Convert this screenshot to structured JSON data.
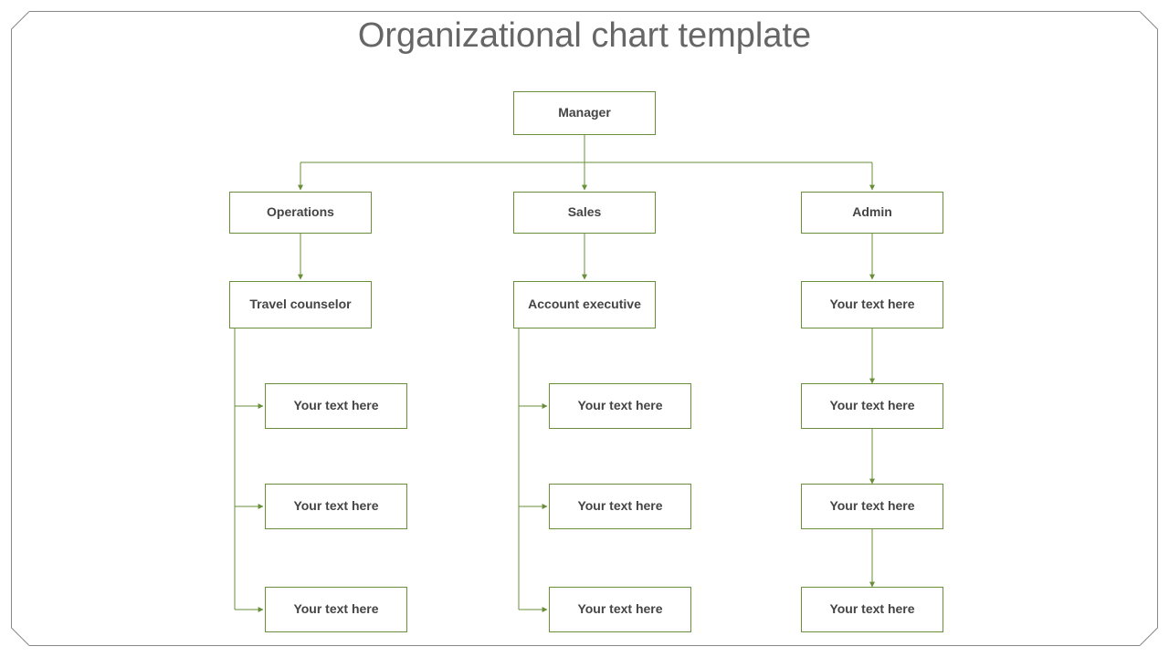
{
  "title": "Organizational chart template",
  "colors": {
    "border": "#6a8f3a",
    "text": "#444",
    "title": "#666"
  },
  "nodes": {
    "manager": "Manager",
    "operations": "Operations",
    "sales": "Sales",
    "admin": "Admin",
    "travel_counselor": "Travel counselor",
    "account_executive": "Account executive",
    "admin_sub": "Your text here",
    "ops_leaf1": "Your text here",
    "ops_leaf2": "Your text here",
    "ops_leaf3": "Your text here",
    "sales_leaf1": "Your text here",
    "sales_leaf2": "Your text here",
    "sales_leaf3": "Your text here",
    "admin_leaf1": "Your text here",
    "admin_leaf2": "Your text here",
    "admin_leaf3": "Your text here"
  },
  "chart_data": {
    "type": "org",
    "title": "Organizational chart template",
    "root": {
      "label": "Manager",
      "children": [
        {
          "label": "Operations",
          "children": [
            {
              "label": "Travel counselor",
              "children": [
                {
                  "label": "Your text here"
                },
                {
                  "label": "Your text here"
                },
                {
                  "label": "Your text here"
                }
              ],
              "child_layout": "hanging"
            }
          ]
        },
        {
          "label": "Sales",
          "children": [
            {
              "label": "Account executive",
              "children": [
                {
                  "label": "Your text here"
                },
                {
                  "label": "Your text here"
                },
                {
                  "label": "Your text here"
                }
              ],
              "child_layout": "hanging"
            }
          ]
        },
        {
          "label": "Admin",
          "children": [
            {
              "label": "Your text here",
              "children": [
                {
                  "label": "Your text here",
                  "children": [
                    {
                      "label": "Your text here",
                      "children": [
                        {
                          "label": "Your text here"
                        }
                      ]
                    }
                  ]
                }
              ]
            }
          ]
        }
      ]
    }
  }
}
